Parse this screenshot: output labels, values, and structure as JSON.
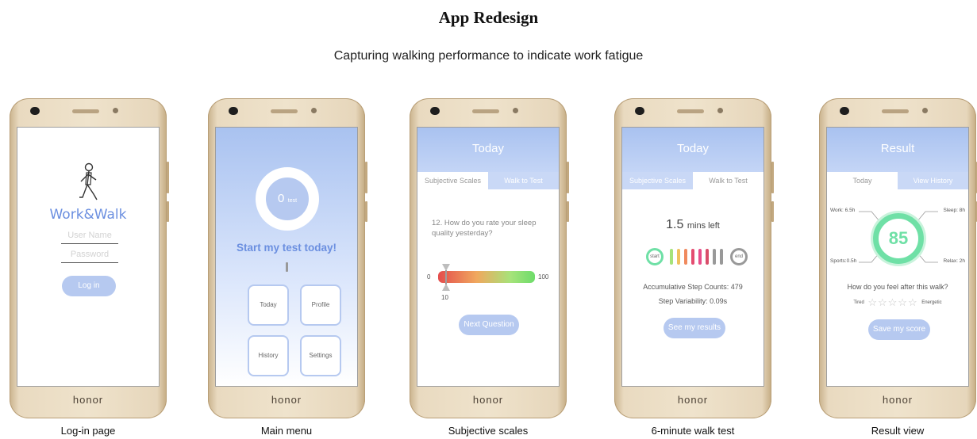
{
  "title": "App Redesign",
  "subtitle": "Capturing walking performance to indicate work fatigue",
  "brand": "honor",
  "captions": [
    "Log-in page",
    "Main menu",
    "Subjective scales",
    "6-minute walk test",
    "Result view"
  ],
  "login": {
    "app_name": "Work&Walk",
    "username_placeholder": "User Name",
    "password_placeholder": "Password",
    "login_button": "Log in"
  },
  "main_menu": {
    "ring_count": "0",
    "ring_unit": "test",
    "cta": "Start my test today!",
    "items": [
      "Today",
      "Profile",
      "History",
      "Settings"
    ]
  },
  "subjective": {
    "header": "Today",
    "tabs": [
      "Subjective Scales",
      "Walk to Test"
    ],
    "question": "12. How do you rate your sleep quality yesterday?",
    "scale_min": "0",
    "scale_max": "100",
    "selected_value": "10",
    "next_button": "Next Question"
  },
  "walk": {
    "header": "Today",
    "tabs": [
      "Subjective Scales",
      "Walk to Test"
    ],
    "time_value": "1.5",
    "time_unit": "mins left",
    "start_label": "start",
    "end_label": "end",
    "step_counts": "Accumulative Step Counts: 479",
    "step_variability": "Step Variability: 0.09s",
    "results_button": "See my results"
  },
  "result": {
    "header": "Result",
    "tabs": [
      "Today",
      "View History"
    ],
    "score": "85",
    "work": "Work: 6.5h",
    "sleep": "Sleep: 8h",
    "sports": "Sports:0.5h",
    "relax": "Relax: 2h",
    "question": "How do you feel after this walk?",
    "low_label": "Tired",
    "high_label": "Energetic",
    "stars": 5,
    "save_button": "Save my score"
  },
  "colors": {
    "accent": "#b6c9f0",
    "link_blue": "#6b8fe0",
    "ring_green": "#6fe0a6"
  }
}
